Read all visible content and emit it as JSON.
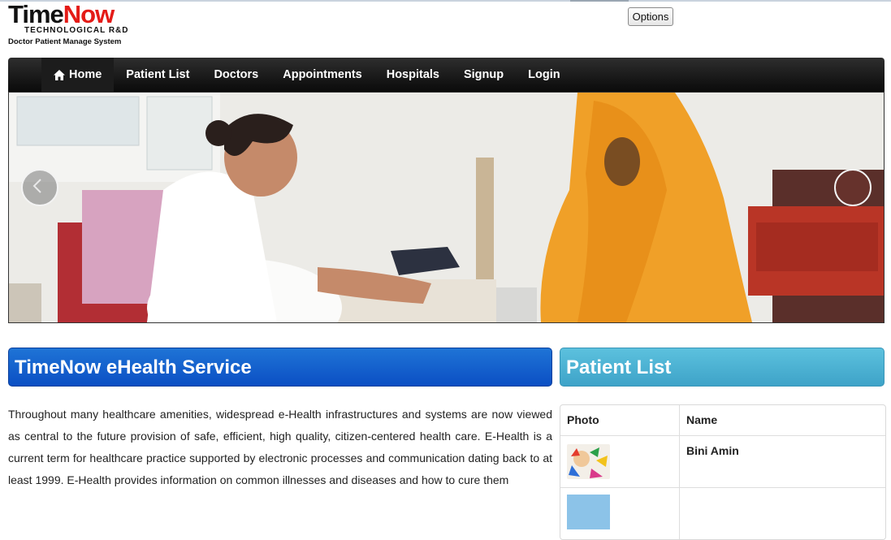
{
  "logo": {
    "word_part1": "Time",
    "word_part2": "Now",
    "subtitle": "TECHNOLOGICAL R&D",
    "tagline": "Doctor Patient Manage System"
  },
  "toolbar": {
    "options_label": "Options"
  },
  "nav": {
    "items": [
      {
        "label": "Home",
        "icon": "home-icon"
      },
      {
        "label": "Patient List"
      },
      {
        "label": "Doctors"
      },
      {
        "label": "Appointments"
      },
      {
        "label": "Hospitals"
      },
      {
        "label": "Signup"
      },
      {
        "label": "Login"
      }
    ]
  },
  "carousel": {
    "prev_icon": "chevron-left-icon",
    "next_icon": "chevron-right-icon"
  },
  "main": {
    "title": "TimeNow eHealth Service",
    "intro": "Throughout many healthcare amenities, widespread e-Health infrastructures and systems are now viewed as central to the future provision of safe, efficient, high quality, citizen-centered health care. E-Health is a current term for healthcare practice supported by electronic processes and communication dating back to at least 1999. E-Health provides information on common illnesses and diseases and how to cure them"
  },
  "patients": {
    "title": "Patient List",
    "columns": [
      "Photo",
      "Name"
    ],
    "rows": [
      {
        "name": "Bini Amin"
      },
      {
        "name": ""
      }
    ]
  },
  "colors": {
    "brand_red": "#e41b17",
    "primary_blue": "#0b4fc4",
    "info_cyan": "#3ea3c8",
    "nav_black": "#0a0a0a"
  }
}
